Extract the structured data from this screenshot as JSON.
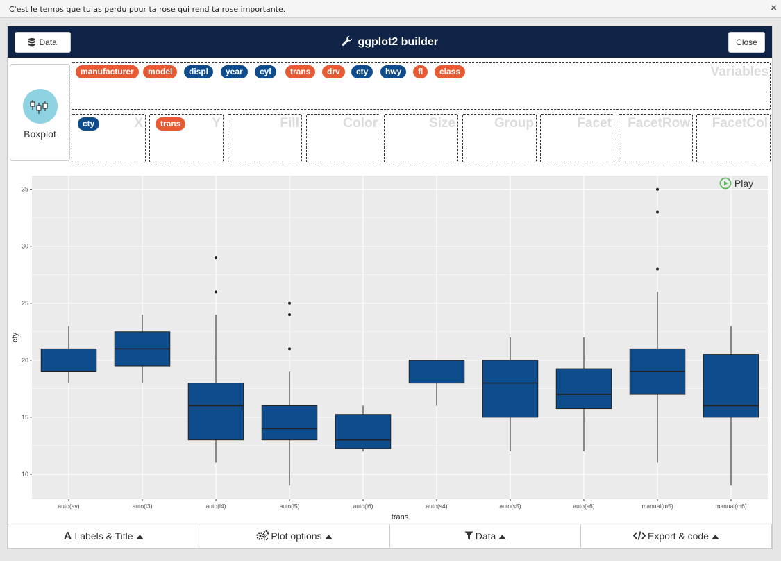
{
  "topbar": {
    "message": "C'est le temps que tu as perdu pour ta rose qui rend ta rose importante.",
    "close_glyph": "×"
  },
  "header": {
    "title": "ggplot2 builder",
    "data_button": "Data",
    "close_button": "Close",
    "color": "#0f2347"
  },
  "geom": {
    "label": "Boxplot"
  },
  "variables": {
    "placeholder": "Variables",
    "items": [
      {
        "name": "manufacturer",
        "type": "categorical"
      },
      {
        "name": "model",
        "type": "categorical"
      },
      {
        "name": "displ",
        "type": "continuous"
      },
      {
        "name": "year",
        "type": "continuous"
      },
      {
        "name": "cyl",
        "type": "continuous"
      },
      {
        "name": "trans",
        "type": "categorical"
      },
      {
        "name": "drv",
        "type": "categorical"
      },
      {
        "name": "cty",
        "type": "continuous"
      },
      {
        "name": "hwy",
        "type": "continuous"
      },
      {
        "name": "fl",
        "type": "categorical"
      },
      {
        "name": "class",
        "type": "categorical"
      }
    ]
  },
  "dropzones": [
    {
      "placeholder": "X",
      "value": "cty",
      "type": "continuous"
    },
    {
      "placeholder": "Y",
      "value": "trans",
      "type": "categorical"
    },
    {
      "placeholder": "Fill",
      "value": ""
    },
    {
      "placeholder": "Color",
      "value": ""
    },
    {
      "placeholder": "Size",
      "value": ""
    },
    {
      "placeholder": "Group",
      "value": ""
    },
    {
      "placeholder": "Facet",
      "value": ""
    },
    {
      "placeholder": "FacetRow",
      "value": ""
    },
    {
      "placeholder": "FacetCol",
      "value": ""
    }
  ],
  "play": {
    "label": "Play"
  },
  "footer": {
    "tabs": [
      {
        "label": "Labels & Title",
        "icon": "font-icon"
      },
      {
        "label": "Plot options",
        "icon": "gears-icon"
      },
      {
        "label": "Data",
        "icon": "filter-icon"
      },
      {
        "label": "Export & code",
        "icon": "code-icon"
      }
    ]
  },
  "colors": {
    "categorical": "#e65b34",
    "continuous": "#0f4c8c",
    "box_fill": "#0f4c8c",
    "panel_bg": "#ebebeb"
  },
  "chart_data": {
    "type": "boxplot",
    "xlabel": "trans",
    "ylabel": "cty",
    "ylim": [
      7.8,
      36.2
    ],
    "yticks": [
      10,
      15,
      20,
      25,
      30,
      35
    ],
    "grid": true,
    "categories": [
      "auto(av)",
      "auto(l3)",
      "auto(l4)",
      "auto(l5)",
      "auto(l6)",
      "auto(s4)",
      "auto(s5)",
      "auto(s6)",
      "manual(m5)",
      "manual(m6)"
    ],
    "boxes": [
      {
        "min": 18,
        "q1": 19,
        "median": 19,
        "q3": 21,
        "max": 23,
        "outliers": []
      },
      {
        "min": 18,
        "q1": 19.5,
        "median": 21,
        "q3": 22.5,
        "max": 24,
        "outliers": []
      },
      {
        "min": 11,
        "q1": 13,
        "median": 16,
        "q3": 18,
        "max": 24,
        "outliers": [
          26,
          29
        ]
      },
      {
        "min": 9,
        "q1": 13,
        "median": 14,
        "q3": 16,
        "max": 19,
        "outliers": [
          21,
          24,
          25
        ]
      },
      {
        "min": 12,
        "q1": 12.25,
        "median": 13,
        "q3": 15.25,
        "max": 16,
        "outliers": []
      },
      {
        "min": 16,
        "q1": 18,
        "median": 20,
        "q3": 20,
        "max": 20,
        "outliers": []
      },
      {
        "min": 12,
        "q1": 15,
        "median": 18,
        "q3": 20,
        "max": 22,
        "outliers": []
      },
      {
        "min": 12,
        "q1": 15.75,
        "median": 17,
        "q3": 19.25,
        "max": 22,
        "outliers": []
      },
      {
        "min": 11,
        "q1": 17,
        "median": 19,
        "q3": 21,
        "max": 26,
        "outliers": [
          28,
          33,
          35
        ]
      },
      {
        "min": 9,
        "q1": 15,
        "median": 16,
        "q3": 20.5,
        "max": 23,
        "outliers": []
      }
    ]
  }
}
